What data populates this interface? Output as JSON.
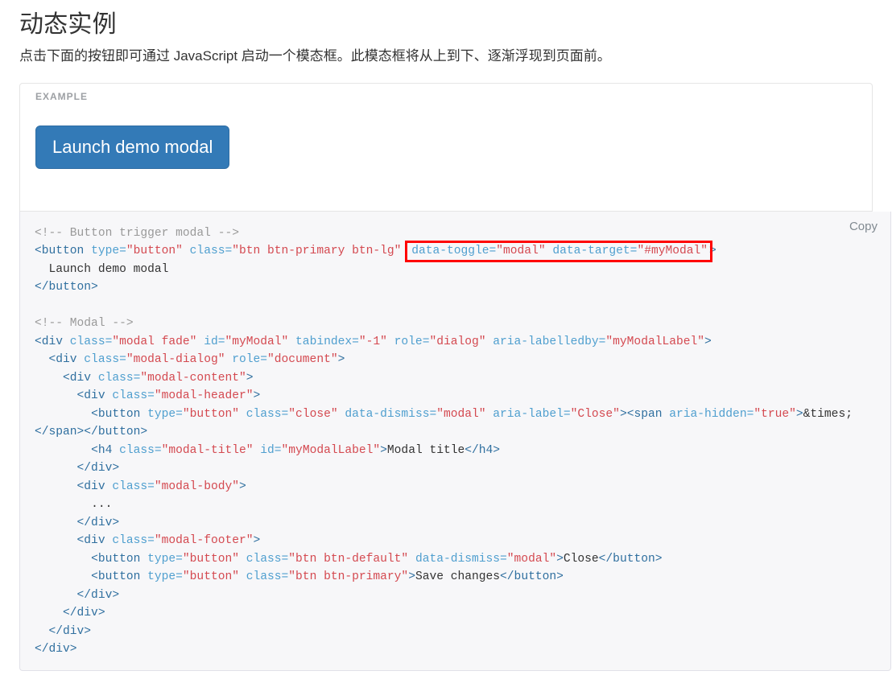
{
  "page": {
    "title": "动态实例",
    "lead": "点击下面的按钮即可通过 JavaScript 启动一个模态框。此模态框将从上到下、逐渐浮现到页面前。"
  },
  "example": {
    "label": "EXAMPLE",
    "button_label": "Launch demo modal",
    "button_color": "#337ab7",
    "border_color": "#2e6da4"
  },
  "code_block": {
    "copy_label": "Copy",
    "background": "#f7f7f9",
    "highlight_color": "#ff0000",
    "colors": {
      "comment": "#999999",
      "tag": "#2f6f9f",
      "attribute": "#4f9fcf",
      "value": "#d44950",
      "text": "#333333"
    },
    "lines": {
      "l1_comment": "<!-- Button trigger modal -->",
      "l2_tag_open": "<button",
      "l2_attr1": " type=",
      "l2_val1": "\"button\"",
      "l2_attr2": " class=",
      "l2_val2": "\"btn btn-primary btn-lg\"",
      "l2_hl_attr3": "data-toggle=",
      "l2_hl_val3": "\"modal\"",
      "l2_hl_attr4": " data-target=",
      "l2_hl_val4": "\"#myModal\"",
      "l2_tag_close": ">",
      "l3_text": "  Launch demo modal",
      "l4_tag": "</button>",
      "l5_comment": "<!-- Modal -->",
      "l6_tag": "<div",
      "l6_attr1": " class=",
      "l6_val1": "\"modal fade\"",
      "l6_attr2": " id=",
      "l6_val2": "\"myModal\"",
      "l6_attr3": " tabindex=",
      "l6_val3": "\"-1\"",
      "l6_attr4": " role=",
      "l6_val4": "\"dialog\"",
      "l6_attr5": " aria-labelledby=",
      "l6_val5": "\"myModalLabel\"",
      "l6_end": ">",
      "l7_indent": "  ",
      "l7_tag": "<div",
      "l7_attr1": " class=",
      "l7_val1": "\"modal-dialog\"",
      "l7_attr2": " role=",
      "l7_val2": "\"document\"",
      "l7_end": ">",
      "l8_indent": "    ",
      "l8_tag": "<div",
      "l8_attr1": " class=",
      "l8_val1": "\"modal-content\"",
      "l8_end": ">",
      "l9_indent": "      ",
      "l9_tag": "<div",
      "l9_attr1": " class=",
      "l9_val1": "\"modal-header\"",
      "l9_end": ">",
      "l10_indent": "        ",
      "l10_tag": "<button",
      "l10_attr1": " type=",
      "l10_val1": "\"button\"",
      "l10_attr2": " class=",
      "l10_val2": "\"close\"",
      "l10_attr3": " data-dismiss=",
      "l10_val3": "\"modal\"",
      "l10_attr4": " aria-label=",
      "l10_val4": "\"Close\"",
      "l10_mid": "><span",
      "l10_attr5": " aria-hidden=",
      "l10_val5": "\"true\"",
      "l10_gt": ">",
      "l10_entity": "&times;",
      "l10_close": "</span></button>",
      "l11_indent": "        ",
      "l11_tag": "<h4",
      "l11_attr1": " class=",
      "l11_val1": "\"modal-title\"",
      "l11_attr2": " id=",
      "l11_val2": "\"myModalLabel\"",
      "l11_gt": ">",
      "l11_text": "Modal title",
      "l11_close": "</h4>",
      "l12_indent": "      ",
      "l12_tag": "</div>",
      "l13_indent": "      ",
      "l13_tag": "<div",
      "l13_attr1": " class=",
      "l13_val1": "\"modal-body\"",
      "l13_end": ">",
      "l14_text": "        ...",
      "l15_indent": "      ",
      "l15_tag": "</div>",
      "l16_indent": "      ",
      "l16_tag": "<div",
      "l16_attr1": " class=",
      "l16_val1": "\"modal-footer\"",
      "l16_end": ">",
      "l17_indent": "        ",
      "l17_tag": "<button",
      "l17_attr1": " type=",
      "l17_val1": "\"button\"",
      "l17_attr2": " class=",
      "l17_val2": "\"btn btn-default\"",
      "l17_attr3": " data-dismiss=",
      "l17_val3": "\"modal\"",
      "l17_gt": ">",
      "l17_text": "Close",
      "l17_close": "</button>",
      "l18_indent": "        ",
      "l18_tag": "<button",
      "l18_attr1": " type=",
      "l18_val1": "\"button\"",
      "l18_attr2": " class=",
      "l18_val2": "\"btn btn-primary\"",
      "l18_gt": ">",
      "l18_text": "Save changes",
      "l18_close": "</button>",
      "l19_indent": "      ",
      "l19_tag": "</div>",
      "l20_indent": "    ",
      "l20_tag": "</div>",
      "l21_indent": "  ",
      "l21_tag": "</div>",
      "l22_tag": "</div>"
    }
  }
}
